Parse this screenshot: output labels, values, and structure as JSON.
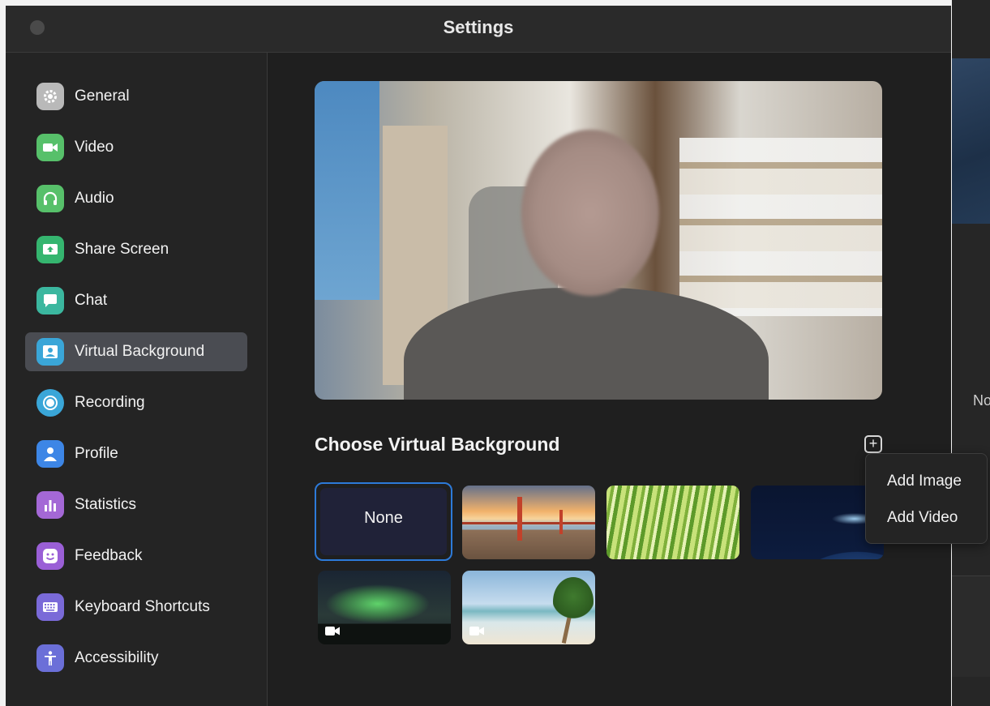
{
  "window": {
    "title": "Settings"
  },
  "sidebar": {
    "items": [
      {
        "label": "General",
        "icon": "gear-icon",
        "color": "#b9b9b9",
        "active": false
      },
      {
        "label": "Video",
        "icon": "video-camera-icon",
        "color": "#57c06a",
        "active": false
      },
      {
        "label": "Audio",
        "icon": "headphones-icon",
        "color": "#57c06a",
        "active": false
      },
      {
        "label": "Share Screen",
        "icon": "share-screen-icon",
        "color": "#35b56f",
        "active": false
      },
      {
        "label": "Chat",
        "icon": "chat-bubble-icon",
        "color": "#3bb79f",
        "active": false
      },
      {
        "label": "Virtual Background",
        "icon": "person-portrait-icon",
        "color": "#3aa6d8",
        "active": true
      },
      {
        "label": "Recording",
        "icon": "record-icon",
        "color": "#3aa6d8",
        "active": false
      },
      {
        "label": "Profile",
        "icon": "person-icon",
        "color": "#3d86e6",
        "active": false
      },
      {
        "label": "Statistics",
        "icon": "bar-chart-icon",
        "color": "#a468d6",
        "active": false
      },
      {
        "label": "Feedback",
        "icon": "smiley-icon",
        "color": "#9a5fd6",
        "active": false
      },
      {
        "label": "Keyboard Shortcuts",
        "icon": "keyboard-icon",
        "color": "#7a6ad8",
        "active": false
      },
      {
        "label": "Accessibility",
        "icon": "accessibility-icon",
        "color": "#6b6fd8",
        "active": false
      }
    ]
  },
  "main": {
    "section_title": "Choose Virtual Background",
    "add_button": "+",
    "backgrounds": [
      {
        "label": "None",
        "selected": true
      },
      {
        "label": "",
        "name": "golden-gate-bridge"
      },
      {
        "label": "",
        "name": "grass"
      },
      {
        "label": "",
        "name": "earth-from-space"
      },
      {
        "label": "",
        "name": "aurora",
        "video": true
      },
      {
        "label": "",
        "name": "beach",
        "video": true
      }
    ]
  },
  "add_menu": {
    "items": [
      "Add Image",
      "Add Video"
    ]
  },
  "background_window": {
    "partial_text": "No"
  },
  "colors": {
    "accent": "#2d7ad8",
    "window_bg": "#1f1f1f",
    "sidebar_active": "#4a4c52"
  }
}
